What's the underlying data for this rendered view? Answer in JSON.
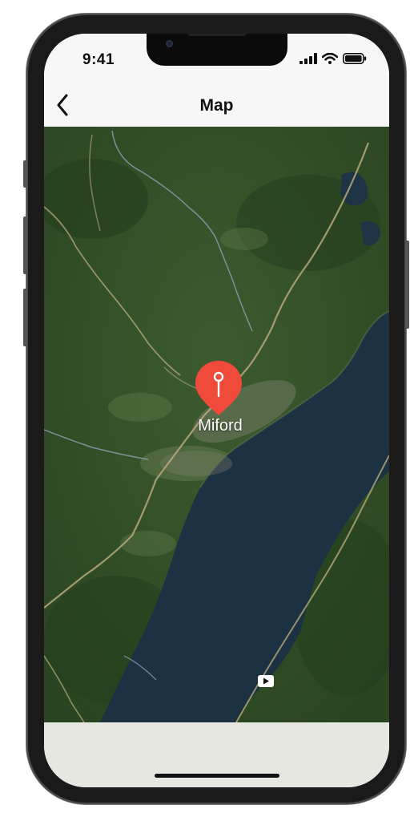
{
  "status_bar": {
    "time": "9:41",
    "icons": [
      "cellular-signal-icon",
      "wifi-icon",
      "battery-icon"
    ]
  },
  "nav_bar": {
    "back_icon": "chevron-left-icon",
    "title": "Map"
  },
  "map": {
    "place_label": "Miford",
    "pin_icon": "map-pin-icon",
    "pin_color": "#f04a3b",
    "media_icon": "play-video-icon"
  },
  "colors": {
    "forest": "#2f4d26",
    "lake": "#1c3142",
    "road": "#b8a97c",
    "bottom_panel": "#e6e7e1"
  }
}
